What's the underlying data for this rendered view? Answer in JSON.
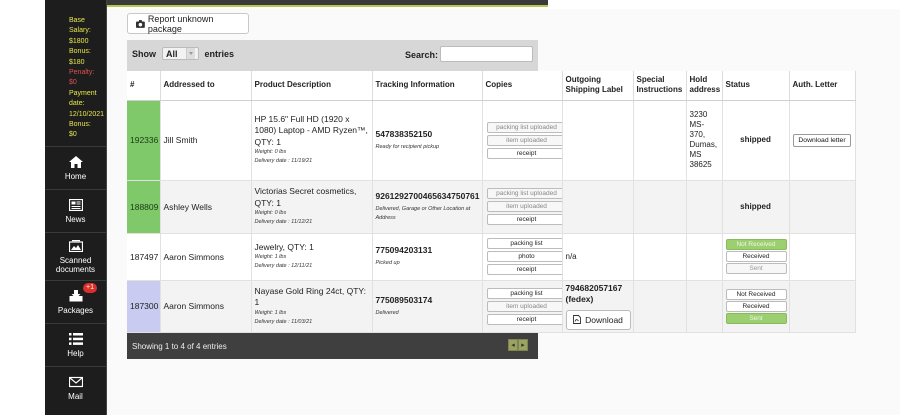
{
  "sidebar": {
    "info": {
      "line1": "Base",
      "line2": "Salary:",
      "line3": "$1800",
      "line4": "Bonus:",
      "line5": "$180",
      "line6": "Penalty:",
      "line7": "$0",
      "line8": "Payment",
      "line9": "date:",
      "line10": "12/10/2021",
      "line11": "Bonus:",
      "line12": "$0"
    },
    "nav": {
      "home": "Home",
      "news": "News",
      "scanned1": "Scanned",
      "scanned2": "documents",
      "packages": "Packages",
      "packages_badge": "+1",
      "help": "Help",
      "mail": "Mail"
    }
  },
  "toolbar": {
    "report_label": "Report unknown package",
    "show_label": "Show",
    "show_value": "All",
    "entries_label": "entries",
    "search_label": "Search:",
    "search_value": ""
  },
  "table": {
    "headers": {
      "num": "#",
      "addressed": "Addressed to",
      "product": "Product Description",
      "tracking": "Tracking Information",
      "copies": "Copies",
      "outgoing": "Outgoing Shipping Label",
      "special": "Special Instructions",
      "hold": "Hold address",
      "status": "Status",
      "letter": "Auth. Letter"
    },
    "rows": [
      {
        "id": "192336",
        "addressed": "Jill Smith",
        "desc": "HP 15.6\" Full HD (1920 x 1080) Laptop - AMD Ryzen™, QTY: 1",
        "weight": "Weight: 0 lbs",
        "delivery": "Delivery date : 11/19/21",
        "tracking": "547838352150",
        "tracking_sub": "Ready for recipient pickup",
        "copies": [
          "packing list uploaded",
          "item uploaded",
          "receipt"
        ],
        "hold": "3230 MS-370, Dumas, MS 38625",
        "status": "shipped",
        "letter": "Download letter"
      },
      {
        "id": "188809",
        "addressed": "Ashley Wells",
        "desc": "Victorias Secret cosmetics, QTY: 1",
        "weight": "Weight: 0 lbs",
        "delivery": "Delivery date : 11/12/21",
        "tracking": "9261292700465634750761",
        "tracking_sub": "Delivered, Garage or Other Location at Address",
        "copies": [
          "packing list uploaded",
          "item uploaded",
          "receipt"
        ],
        "status": "shipped"
      },
      {
        "id": "187497",
        "addressed": "Aaron Simmons",
        "desc": "Jewelry, QTY: 1",
        "weight": "Weight: 1 lbs",
        "delivery": "Delivery date : 12/11/21",
        "tracking": "775094203131",
        "tracking_sub": "Picked up",
        "copies": [
          "packing list",
          "photo",
          "receipt"
        ],
        "outgoing": "n/a",
        "status_buttons": [
          "Not Received",
          "Received",
          "Sent"
        ]
      },
      {
        "id": "187300",
        "addressed": "Aaron Simmons",
        "desc": "Nayase Gold Ring 24ct, QTY: 1",
        "weight": "Weight: 1 lbs",
        "delivery": "Delivery date : 11/03/21",
        "tracking": "775089503174",
        "tracking_sub": "Delivered",
        "copies": [
          "packing list",
          "item uploaded",
          "receipt"
        ],
        "outgoing": "794682057167 (fedex)",
        "download": "Download",
        "status_buttons": [
          "Not Received",
          "Received",
          "Sent"
        ]
      }
    ]
  },
  "footer": {
    "info": "Showing 1 to 4 of 4 entries",
    "prev": "◂",
    "next": "▸"
  },
  "colors": {
    "sidebar_bg": "#1d1d1d",
    "sidebar_text": "#e8e84a",
    "id_green": "#7fc96b",
    "id_violet": "#c9ccf0",
    "status_active": "#9ccf6f",
    "accent": "#b7c94a"
  }
}
